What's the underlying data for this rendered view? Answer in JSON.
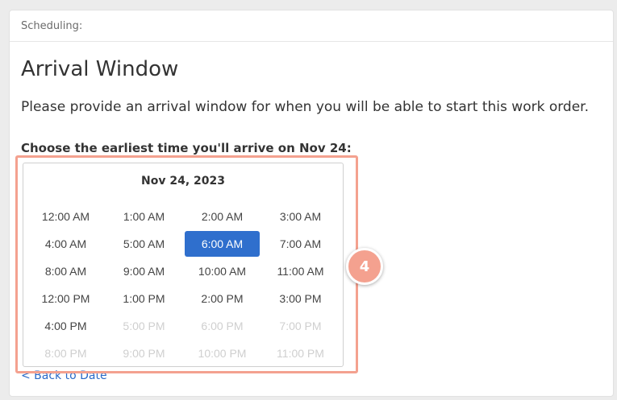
{
  "header": {
    "section_label": "Scheduling:"
  },
  "main": {
    "title": "Arrival Window",
    "description": "Please provide an arrival window for when you will be able to start this work order.",
    "prompt": "Choose the earliest time you'll arrive on Nov 24:",
    "back_link": "< Back to Date"
  },
  "picker": {
    "date": "Nov 24, 2023",
    "selected": "6:00 AM",
    "slots": [
      {
        "label": "12:00 AM",
        "state": "enabled"
      },
      {
        "label": "1:00 AM",
        "state": "enabled"
      },
      {
        "label": "2:00 AM",
        "state": "enabled"
      },
      {
        "label": "3:00 AM",
        "state": "enabled"
      },
      {
        "label": "4:00 AM",
        "state": "enabled"
      },
      {
        "label": "5:00 AM",
        "state": "enabled"
      },
      {
        "label": "6:00 AM",
        "state": "selected"
      },
      {
        "label": "7:00 AM",
        "state": "enabled"
      },
      {
        "label": "8:00 AM",
        "state": "enabled"
      },
      {
        "label": "9:00 AM",
        "state": "enabled"
      },
      {
        "label": "10:00 AM",
        "state": "enabled"
      },
      {
        "label": "11:00 AM",
        "state": "enabled"
      },
      {
        "label": "12:00 PM",
        "state": "enabled"
      },
      {
        "label": "1:00 PM",
        "state": "enabled"
      },
      {
        "label": "2:00 PM",
        "state": "enabled"
      },
      {
        "label": "3:00 PM",
        "state": "enabled"
      },
      {
        "label": "4:00 PM",
        "state": "enabled"
      },
      {
        "label": "5:00 PM",
        "state": "disabled"
      },
      {
        "label": "6:00 PM",
        "state": "disabled"
      },
      {
        "label": "7:00 PM",
        "state": "disabled"
      },
      {
        "label": "8:00 PM",
        "state": "disabled"
      },
      {
        "label": "9:00 PM",
        "state": "disabled"
      },
      {
        "label": "10:00 PM",
        "state": "disabled"
      },
      {
        "label": "11:00 PM",
        "state": "disabled"
      }
    ]
  },
  "annotation": {
    "step_number": "4",
    "color": "#f4a18f"
  },
  "colors": {
    "selected_bg": "#2f6fcd",
    "link": "#2a6ac8",
    "disabled_text": "#cfcfcf"
  }
}
